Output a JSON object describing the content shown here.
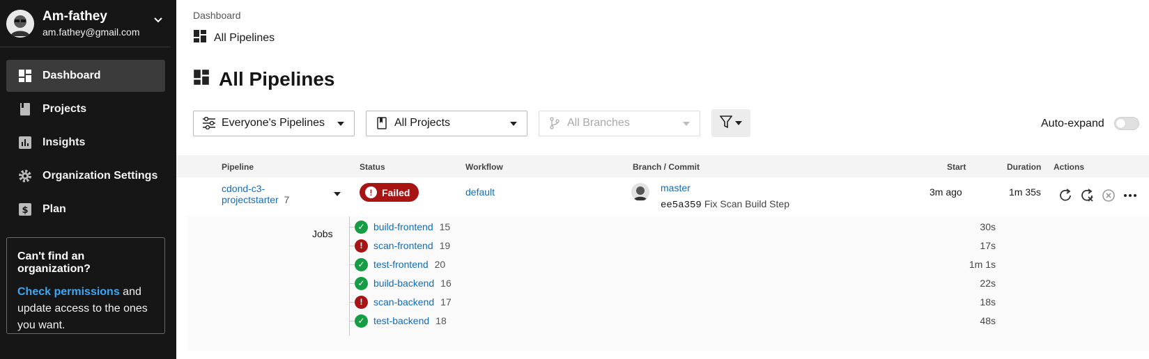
{
  "user": {
    "name": "Am-fathey",
    "email": "am.fathey@gmail.com"
  },
  "nav": [
    {
      "label": "Dashboard",
      "icon": "dashboard-icon",
      "active": true
    },
    {
      "label": "Projects",
      "icon": "book-icon"
    },
    {
      "label": "Insights",
      "icon": "bar-chart-icon"
    },
    {
      "label": "Organization Settings",
      "icon": "gear-icon"
    },
    {
      "label": "Plan",
      "icon": "dollar-icon"
    }
  ],
  "card": {
    "title": "Can't find an organization?",
    "link": "Check permissions",
    "text": " and update access to the ones you want."
  },
  "breadcrumb": "Dashboard",
  "subtitle": "All Pipelines",
  "title": "All Pipelines",
  "filters": {
    "pipelines": "Everyone's Pipelines",
    "projects": "All Projects",
    "branches": "All Branches"
  },
  "auto_expand": {
    "label": "Auto-expand",
    "on": false
  },
  "table": {
    "headers": {
      "pipeline": "Pipeline",
      "status": "Status",
      "workflow": "Workflow",
      "branch": "Branch / Commit",
      "start": "Start",
      "duration": "Duration",
      "actions": "Actions"
    },
    "row": {
      "pipeline": "cdond-c3-projectstarter",
      "number": "7",
      "status": "Failed",
      "workflow": "default",
      "branch": "master",
      "sha": "ee5a359",
      "message": "Fix Scan Build Step",
      "start": "3m ago",
      "duration": "1m 35s"
    },
    "jobs_label": "Jobs",
    "jobs": [
      {
        "name": "build-frontend",
        "number": "15",
        "duration": "30s",
        "status": "success"
      },
      {
        "name": "scan-frontend",
        "number": "19",
        "duration": "17s",
        "status": "failed"
      },
      {
        "name": "test-frontend",
        "number": "20",
        "duration": "1m 1s",
        "status": "success"
      },
      {
        "name": "build-backend",
        "number": "16",
        "duration": "22s",
        "status": "success"
      },
      {
        "name": "scan-backend",
        "number": "17",
        "duration": "18s",
        "status": "failed"
      },
      {
        "name": "test-backend",
        "number": "18",
        "duration": "48s",
        "status": "success"
      }
    ]
  },
  "colors": {
    "sidebar": "#161616",
    "failed": "#a71414",
    "success": "#169c45",
    "link": "#0f6cbd"
  }
}
